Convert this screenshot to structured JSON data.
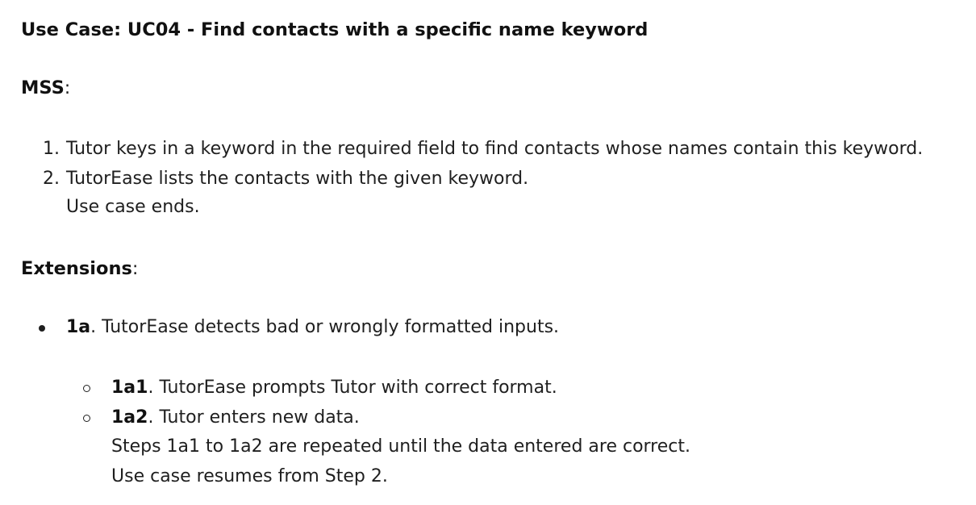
{
  "title": "Use Case: UC04 - Find contacts with a specific name keyword",
  "mss": {
    "label": "MSS",
    "colon": ":",
    "steps": [
      {
        "number": "1.",
        "text": "Tutor keys in a keyword in the required field to find contacts whose names contain this keyword."
      },
      {
        "number": "2.",
        "text": "TutorEase lists the contacts with the given keyword."
      }
    ],
    "end_note": "Use case ends."
  },
  "extensions": {
    "label": "Extensions",
    "colon": ":",
    "items": [
      {
        "id": "1a",
        "text": ". TutorEase detects bad or wrongly formatted inputs.",
        "sub_items": [
          {
            "id": "1a1",
            "text": ". TutorEase prompts Tutor with correct format."
          },
          {
            "id": "1a2",
            "text": ". Tutor enters new data."
          }
        ],
        "notes": [
          "Steps 1a1 to 1a2 are repeated until the data entered are correct.",
          "Use case resumes from Step 2."
        ]
      }
    ]
  }
}
